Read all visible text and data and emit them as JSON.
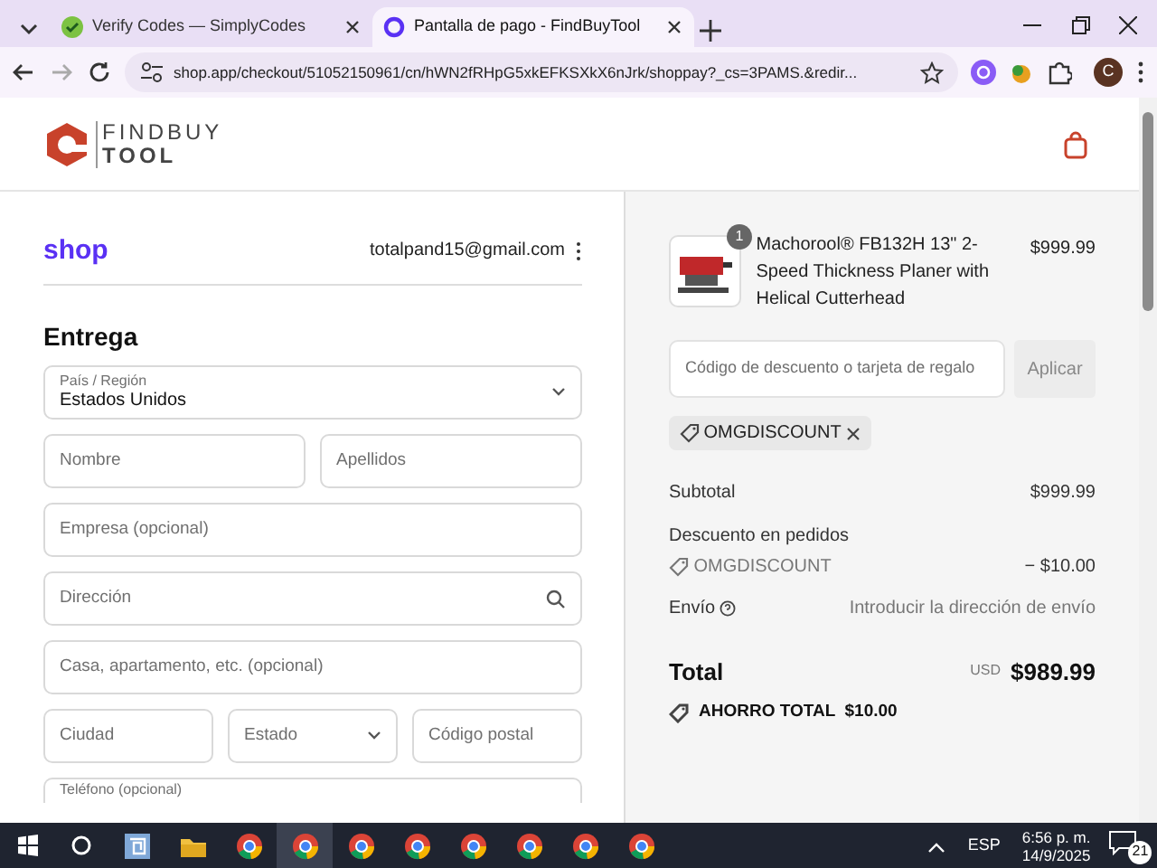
{
  "browser": {
    "tabs": [
      {
        "title": "Verify Codes — SimplyCodes",
        "selected": false
      },
      {
        "title": "Pantalla de pago - FindBuyTool",
        "selected": true
      }
    ],
    "url": "shop.app/checkout/51052150961/cn/hWN2fRHpG5xkEFKSXkX6nJrk/shoppay?_cs=3PAMS.&redir...",
    "profile": "C"
  },
  "store_header": {
    "logo_line_1": "FINDBUY",
    "logo_line_2": "TOOL"
  },
  "checkout": {
    "brand": "shop",
    "email": "totalpand15@gmail.com",
    "heading": "Entrega",
    "field_rows": [
      [
        {
          "kind": "select",
          "label": "País / Región",
          "value": "Estados Unidos"
        }
      ],
      [
        {
          "kind": "text",
          "placeholder": "Nombre"
        },
        {
          "kind": "text",
          "placeholder": "Apellidos"
        }
      ],
      [
        {
          "kind": "text",
          "placeholder": "Empresa (opcional)"
        }
      ],
      [
        {
          "kind": "search",
          "placeholder": "Dirección"
        }
      ],
      [
        {
          "kind": "text",
          "placeholder": "Casa, apartamento, etc. (opcional)"
        }
      ],
      [
        {
          "kind": "text",
          "placeholder": "Ciudad"
        },
        {
          "kind": "select",
          "placeholder": "Estado"
        },
        {
          "kind": "text",
          "placeholder": "Código postal"
        }
      ],
      [
        {
          "kind": "phone",
          "label": "Teléfono (opcional)"
        }
      ]
    ]
  },
  "summary": {
    "item": {
      "quantity": "1",
      "name": "Machorool® FB132H 13\" 2-Speed Thickness Planer with Helical Cutterhead",
      "price": "$999.99"
    },
    "discount_field": {
      "placeholder": "Código de descuento o tarjeta de regalo"
    },
    "apply_button": "Aplicar",
    "applied_code": "OMGDISCOUNT",
    "subtotal_label": "Subtotal",
    "subtotal": "$999.99",
    "order_discount_label": "Descuento en pedidos",
    "order_discount_code": "OMGDISCOUNT",
    "order_discount": "− $10.00",
    "shipping_label": "Envío",
    "shipping_value": "Introducir la dirección de envío",
    "total_label": "Total",
    "currency": "USD",
    "total": "$989.99",
    "savings": "AHORRO TOTAL  $10.00"
  },
  "taskbar": {
    "apps": [
      {
        "kind": "explorer",
        "selected": false
      },
      {
        "kind": "files",
        "selected": false
      },
      {
        "kind": "browser",
        "selected": false
      },
      {
        "kind": "browser",
        "selected": true
      },
      {
        "kind": "browser",
        "selected": false
      },
      {
        "kind": "browser",
        "selected": false
      },
      {
        "kind": "browser",
        "selected": false
      },
      {
        "kind": "browser",
        "selected": false
      },
      {
        "kind": "browser",
        "selected": false
      },
      {
        "kind": "browser",
        "selected": false
      }
    ],
    "language": "ESP",
    "time": "6:56 p. m.",
    "date": "14/9/2025",
    "notifications": "21"
  }
}
